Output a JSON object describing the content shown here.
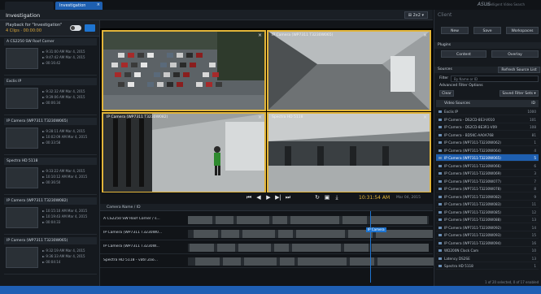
{
  "tabs": [
    {
      "label": ""
    },
    {
      "label": "Investigation"
    }
  ],
  "tab_close": "×",
  "brand": {
    "logo": "ASUS",
    "sub": "Intelligent Video Search"
  },
  "header": {
    "title": "Investigation",
    "layout": "⊞ 2x2 ▾"
  },
  "playback": {
    "title": "Playback for \"Investigation\"",
    "count": "4 Clips · 00:00:00"
  },
  "clips": [
    {
      "name": "A CS2250 SW Roof Corner",
      "lines": [
        "► 9:31:00 AM  Mar 4, 2015",
        "► 9:47:42 AM  Mar 4, 2015",
        "► 00:16:42"
      ]
    },
    {
      "name": "Exclis IP",
      "lines": [
        "► 9:32:32 AM  Mar 4, 2015",
        "► 9:39:06 AM  Mar 4, 2015",
        "► 00:06:34"
      ]
    },
    {
      "name": "IP Camera (WP7311 T3230W065)",
      "lines": [
        "► 9:28:11 AM  Mar 4, 2015",
        "► 10:02:09 AM  Mar 4, 2015",
        "► 00:33:58"
      ]
    },
    {
      "name": "Spectra HD 5118",
      "lines": [
        "► 9:33:22 AM  Mar 4, 2015",
        "► 10:10:12 AM  Mar 4, 2015",
        "► 00:36:50"
      ]
    },
    {
      "name": "IP Camera (WP7311 T3230W082)",
      "lines": [
        "► 10:15:10 AM  Mar 4, 2015",
        "► 10:19:43 AM  Mar 4, 2015",
        "► 00:04:33"
      ]
    },
    {
      "name": "IP Camera (WP7311 T3230W065)",
      "lines": [
        "► 9:32:19 AM  Mar 4, 2015",
        "► 9:36:33 AM  Mar 4, 2015",
        "► 00:04:14"
      ]
    }
  ],
  "tiles": [
    {
      "label": "",
      "close": "×"
    },
    {
      "label": "IP Camera (WP7311 T3230W065)",
      "close": "×"
    },
    {
      "label": "IP Camera (WP7311 T3230W082)",
      "close": "×"
    },
    {
      "label": "Spectra HD 5118",
      "close": "×"
    }
  ],
  "controls": {
    "buttons": [
      "⏮",
      "◀",
      "▶",
      "▶|",
      "⏭"
    ],
    "tools": [
      "↻",
      "▣",
      "⤓"
    ],
    "time": "10:31:54 AM",
    "date": "Mar 04, 2015"
  },
  "timeline": {
    "header": "Camera Name / ID",
    "rows": [
      "A CS2250 SW Roof Corner / s...",
      "IP Camera (WP7311 T3230W0...",
      "IP Camera (WP7311 T3230W...",
      "Spectra HD 5118 - vatil Zoo..."
    ],
    "playhead_label": "IP Camera"
  },
  "panel": {
    "title": "Client",
    "buttons": [
      "New",
      "Save",
      "Workspaces"
    ],
    "plugins_label": "Plugins",
    "plugin_buttons": [
      "Content",
      "Overlay"
    ],
    "sources_label": "Sources",
    "refresh_label": "Refresh Source List",
    "filter_label": "Filter",
    "filter_placeholder": "By Name or ID",
    "advanced_label": "Advanced Filter Options",
    "clear_label": "Clear",
    "saved_label": "Saved Filter Sets ▾",
    "list_header": "Video Sources",
    "list_header_count": "ID",
    "footer": "1 of 20 selected, 0 of 17 enabled"
  },
  "sources": [
    {
      "name": "Exclis IP",
      "count": "1000"
    },
    {
      "name": "IP Camera - DS2CD-8E3-V010",
      "count": "101"
    },
    {
      "name": "IP Camera - DS2CD-8E3R1-V09",
      "count": "108"
    },
    {
      "name": "IP Camera - BD5KC-AA0A768",
      "count": "81"
    },
    {
      "name": "IP Camera (WP7311-T3230W062)",
      "count": "1"
    },
    {
      "name": "IP Camera (WP7311-T3230W064)",
      "count": "4"
    },
    {
      "name": "IP Camera (WP7311-T3230W065)",
      "count": "5",
      "selected": true
    },
    {
      "name": "IP Camera (WP7311-T3230W066)",
      "count": "6"
    },
    {
      "name": "IP Camera (WP7311-T3230W069)",
      "count": "3"
    },
    {
      "name": "IP Camera (WP7311-T3230W077)",
      "count": "7"
    },
    {
      "name": "IP Camera (WP7311-T3230W078)",
      "count": "8"
    },
    {
      "name": "IP Camera (WP7311-T3230W082)",
      "count": "9"
    },
    {
      "name": "IP Camera (WP7311-T3230W083)",
      "count": "11"
    },
    {
      "name": "IP Camera (WP7311-T3230W085)",
      "count": "12"
    },
    {
      "name": "IP Camera (WP7311-T3230W088)",
      "count": "13"
    },
    {
      "name": "IP Camera (WP7311-T3230W092)",
      "count": "14"
    },
    {
      "name": "IP Camera (WP7311-T3230W093)",
      "count": "15"
    },
    {
      "name": "IP Camera (WP7311-T3230W094)",
      "count": "16"
    },
    {
      "name": "WD200N Clock Cam",
      "count": "10"
    },
    {
      "name": "Latency DS2SE",
      "count": "13"
    },
    {
      "name": "Spectra HD 5118",
      "count": "1"
    }
  ],
  "colors": {
    "accent": "#1e74d0",
    "highlight": "#e2b53a",
    "status_bar": "#1f5fb4"
  }
}
